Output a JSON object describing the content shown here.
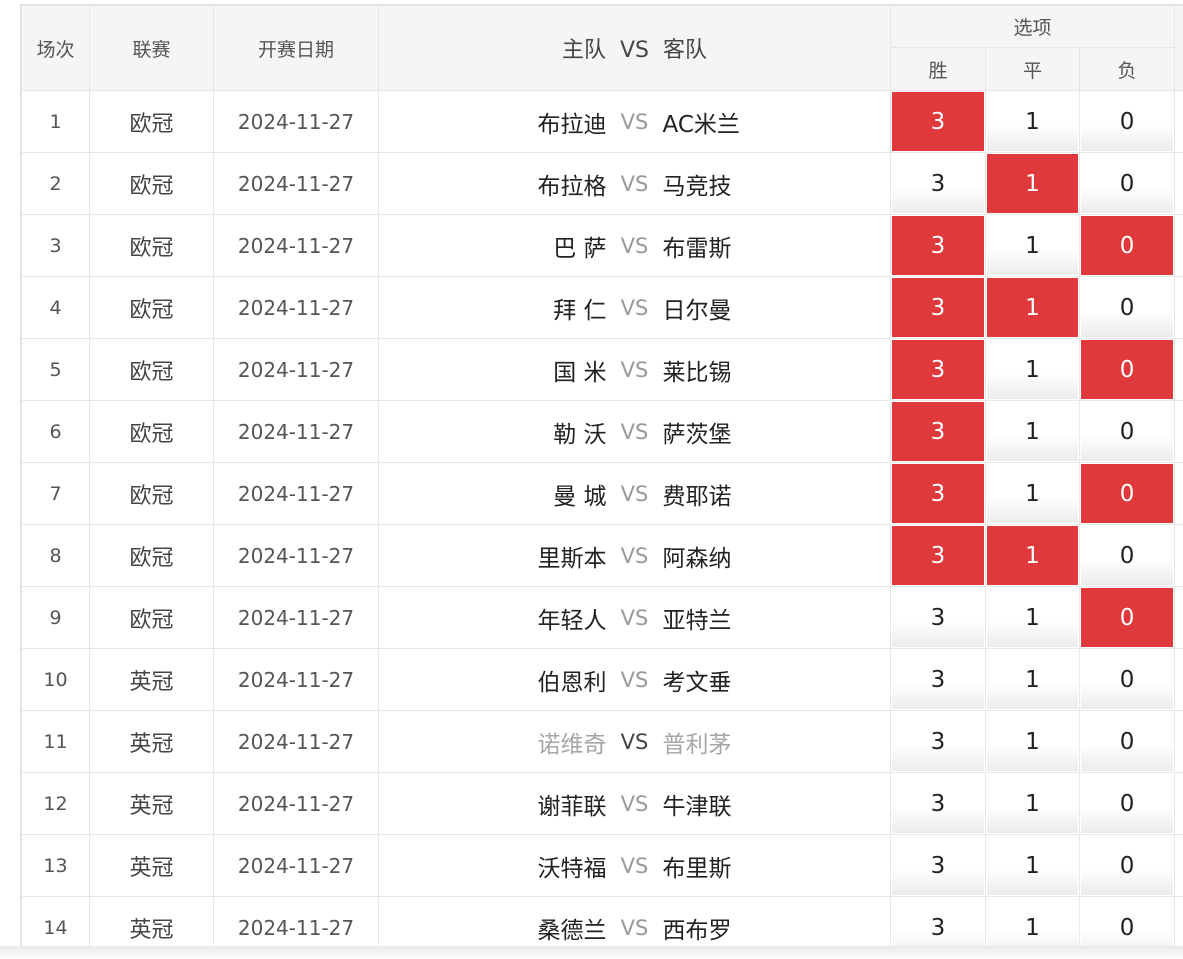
{
  "header": {
    "col_index": "场次",
    "col_league": "联赛",
    "col_date": "开赛日期",
    "col_home": "主队",
    "col_vs": "VS",
    "col_away": "客队",
    "col_options": "选项",
    "opt_win": "胜",
    "opt_draw": "平",
    "opt_lose": "负"
  },
  "colors": {
    "selected": "#e0393c",
    "muted_text": "#a6a6a6"
  },
  "matches": [
    {
      "no": "1",
      "league": "欧冠",
      "date": "2024-11-27",
      "home": "布拉迪",
      "vs": "VS",
      "away": "AC米兰",
      "win": "3",
      "draw": "1",
      "lose": "0",
      "win_sel": true,
      "draw_sel": false,
      "lose_sel": false
    },
    {
      "no": "2",
      "league": "欧冠",
      "date": "2024-11-27",
      "home": "布拉格",
      "vs": "VS",
      "away": "马竞技",
      "win": "3",
      "draw": "1",
      "lose": "0",
      "win_sel": false,
      "draw_sel": true,
      "lose_sel": false
    },
    {
      "no": "3",
      "league": "欧冠",
      "date": "2024-11-27",
      "home": "巴 萨",
      "vs": "VS",
      "away": "布雷斯",
      "win": "3",
      "draw": "1",
      "lose": "0",
      "win_sel": true,
      "draw_sel": false,
      "lose_sel": true
    },
    {
      "no": "4",
      "league": "欧冠",
      "date": "2024-11-27",
      "home": "拜 仁",
      "vs": "VS",
      "away": "日尔曼",
      "win": "3",
      "draw": "1",
      "lose": "0",
      "win_sel": true,
      "draw_sel": true,
      "lose_sel": false
    },
    {
      "no": "5",
      "league": "欧冠",
      "date": "2024-11-27",
      "home": "国 米",
      "vs": "VS",
      "away": "莱比锡",
      "win": "3",
      "draw": "1",
      "lose": "0",
      "win_sel": true,
      "draw_sel": false,
      "lose_sel": true
    },
    {
      "no": "6",
      "league": "欧冠",
      "date": "2024-11-27",
      "home": "勒 沃",
      "vs": "VS",
      "away": "萨茨堡",
      "win": "3",
      "draw": "1",
      "lose": "0",
      "win_sel": true,
      "draw_sel": false,
      "lose_sel": false
    },
    {
      "no": "7",
      "league": "欧冠",
      "date": "2024-11-27",
      "home": "曼 城",
      "vs": "VS",
      "away": "费耶诺",
      "win": "3",
      "draw": "1",
      "lose": "0",
      "win_sel": true,
      "draw_sel": false,
      "lose_sel": true
    },
    {
      "no": "8",
      "league": "欧冠",
      "date": "2024-11-27",
      "home": "里斯本",
      "vs": "VS",
      "away": "阿森纳",
      "win": "3",
      "draw": "1",
      "lose": "0",
      "win_sel": true,
      "draw_sel": true,
      "lose_sel": false
    },
    {
      "no": "9",
      "league": "欧冠",
      "date": "2024-11-27",
      "home": "年轻人",
      "vs": "VS",
      "away": "亚特兰",
      "win": "3",
      "draw": "1",
      "lose": "0",
      "win_sel": false,
      "draw_sel": false,
      "lose_sel": true
    },
    {
      "no": "10",
      "league": "英冠",
      "date": "2024-11-27",
      "home": "伯恩利",
      "vs": "VS",
      "away": "考文垂",
      "win": "3",
      "draw": "1",
      "lose": "0",
      "win_sel": false,
      "draw_sel": false,
      "lose_sel": false
    },
    {
      "no": "11",
      "league": "英冠",
      "date": "2024-11-27",
      "home": "诺维奇",
      "vs": "VS",
      "away": "普利茅",
      "win": "3",
      "draw": "1",
      "lose": "0",
      "win_sel": false,
      "draw_sel": false,
      "lose_sel": false,
      "muted": true
    },
    {
      "no": "12",
      "league": "英冠",
      "date": "2024-11-27",
      "home": "谢菲联",
      "vs": "VS",
      "away": "牛津联",
      "win": "3",
      "draw": "1",
      "lose": "0",
      "win_sel": false,
      "draw_sel": false,
      "lose_sel": false
    },
    {
      "no": "13",
      "league": "英冠",
      "date": "2024-11-27",
      "home": "沃特福",
      "vs": "VS",
      "away": "布里斯",
      "win": "3",
      "draw": "1",
      "lose": "0",
      "win_sel": false,
      "draw_sel": false,
      "lose_sel": false
    },
    {
      "no": "14",
      "league": "英冠",
      "date": "2024-11-27",
      "home": "桑德兰",
      "vs": "VS",
      "away": "西布罗",
      "win": "3",
      "draw": "1",
      "lose": "0",
      "win_sel": false,
      "draw_sel": false,
      "lose_sel": false
    }
  ]
}
